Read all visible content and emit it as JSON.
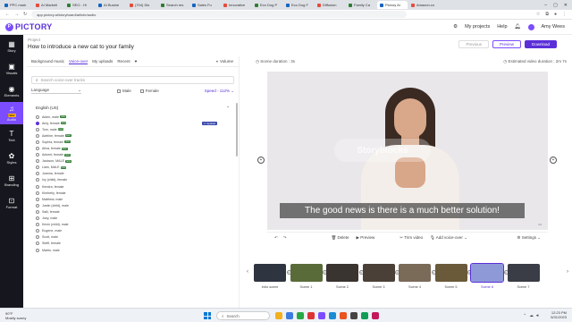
{
  "browser": {
    "tabs": [
      "PPC mark",
      "AI Marketi",
      "SEO - Hi",
      "AI Busine",
      "(704) Dis",
      "Search res",
      "Sales Fu",
      "Innovative",
      "Eco Dog P",
      "Eco Dog F",
      "Diffusion",
      "Family Ca",
      "Pictory AI",
      "Amazon.co"
    ],
    "active_tab_index": 12,
    "url": "app.pictory.ai/storyboard/article/audio",
    "window_controls": [
      "–",
      "▢",
      "✕"
    ]
  },
  "app": {
    "logo_text": "PICTORY",
    "header_links": [
      "My projects",
      "Help"
    ],
    "user_name": "Amy Wees",
    "brand_color": "#5b2fd8"
  },
  "sidebar": {
    "items": [
      {
        "label": "Story",
        "icon": "story-icon",
        "glyph": "▦"
      },
      {
        "label": "Visuals",
        "icon": "visuals-icon",
        "glyph": "▣"
      },
      {
        "label": "Elements",
        "icon": "elements-icon",
        "glyph": "◉"
      },
      {
        "label": "Audio",
        "icon": "audio-icon",
        "glyph": "♫",
        "badge": "NEW",
        "active": true
      },
      {
        "label": "Text",
        "icon": "text-icon",
        "glyph": "T"
      },
      {
        "label": "Styles",
        "icon": "styles-icon",
        "glyph": "✿"
      },
      {
        "label": "Branding",
        "icon": "branding-icon",
        "glyph": "⊞"
      },
      {
        "label": "Format",
        "icon": "format-icon",
        "glyph": "⊡"
      }
    ]
  },
  "project": {
    "label": "Project",
    "title": "How to introduce a new cat to your family",
    "previous_label": "Previous",
    "preview_label": "Preview",
    "download_label": "Download"
  },
  "audio_panel": {
    "tabs": [
      "Background music",
      "Voice-over",
      "My uploads",
      "Recent"
    ],
    "active_tab": "Voice-over",
    "volume_label": "Volume",
    "search_placeholder": "Search voice-over tracks",
    "language_label": "Language",
    "male_label": "Male",
    "female_label": "Female",
    "speed_label": "Speed - 112%",
    "section_title": "English (US)",
    "applied_label": "Applied",
    "voices": [
      {
        "name": "Aiden, male",
        "new": true
      },
      {
        "name": "Amy, female",
        "new": true,
        "selected": true,
        "applied": true
      },
      {
        "name": "Tom, male",
        "new": true
      },
      {
        "name": "Adeline, female",
        "new": true
      },
      {
        "name": "Sophia, female",
        "new": true
      },
      {
        "name": "Alina, female",
        "new": true
      },
      {
        "name": "Advent, female",
        "new": true
      },
      {
        "name": "Jackson, MALE",
        "new": true
      },
      {
        "name": "Liam, MALE",
        "new": true
      },
      {
        "name": "Joanna, female"
      },
      {
        "name": "Ivy (child), female"
      },
      {
        "name": "Kendra, female"
      },
      {
        "name": "Kimberly, female"
      },
      {
        "name": "Matthew, male"
      },
      {
        "name": "Justin (child), male"
      },
      {
        "name": "Salli, female"
      },
      {
        "name": "Joey, male"
      },
      {
        "name": "Kevin (child), male"
      },
      {
        "name": "Eugene, male"
      },
      {
        "name": "Scott, male"
      },
      {
        "name": "Steffi, female"
      },
      {
        "name": "Martin, male"
      }
    ]
  },
  "preview": {
    "scene_duration": "Scene duration : 3s",
    "estimated_duration": "Estimated video duration : 2m 7s",
    "caption": "The good news is there is a much better solution!",
    "watermark": "Storyblocks",
    "toolbar": {
      "delete_label": "Delete",
      "preview_label": "Preview",
      "trim_label": "Trim video",
      "add_voice_label": "Add voice-over",
      "settings_label": "Settings"
    }
  },
  "timeline": {
    "scenes": [
      "Intro scene",
      "Scene 1",
      "Scene 2",
      "Scene 3",
      "Scene 4",
      "Scene 5",
      "Scene 6",
      "Scene 7"
    ],
    "active_scene": "Scene 6",
    "thumb_colors": [
      "#2f3540",
      "#5a6b3a",
      "#3a3430",
      "#4a4038",
      "#7a6a58",
      "#6a5a3a",
      "#8e9ad8",
      "#3a3d45"
    ]
  },
  "taskbar": {
    "weather_temp": "90°F",
    "weather_desc": "Mostly sunny",
    "search_label": "Search",
    "time": "12:23 PM",
    "date": "5/31/2023",
    "app_colors": [
      "#f2b01e",
      "#3d7be0",
      "#28a745",
      "#d33",
      "#7c4dff",
      "#1b8bd3",
      "#e95420",
      "#444",
      "#0f9d58",
      "#c2185b"
    ]
  }
}
